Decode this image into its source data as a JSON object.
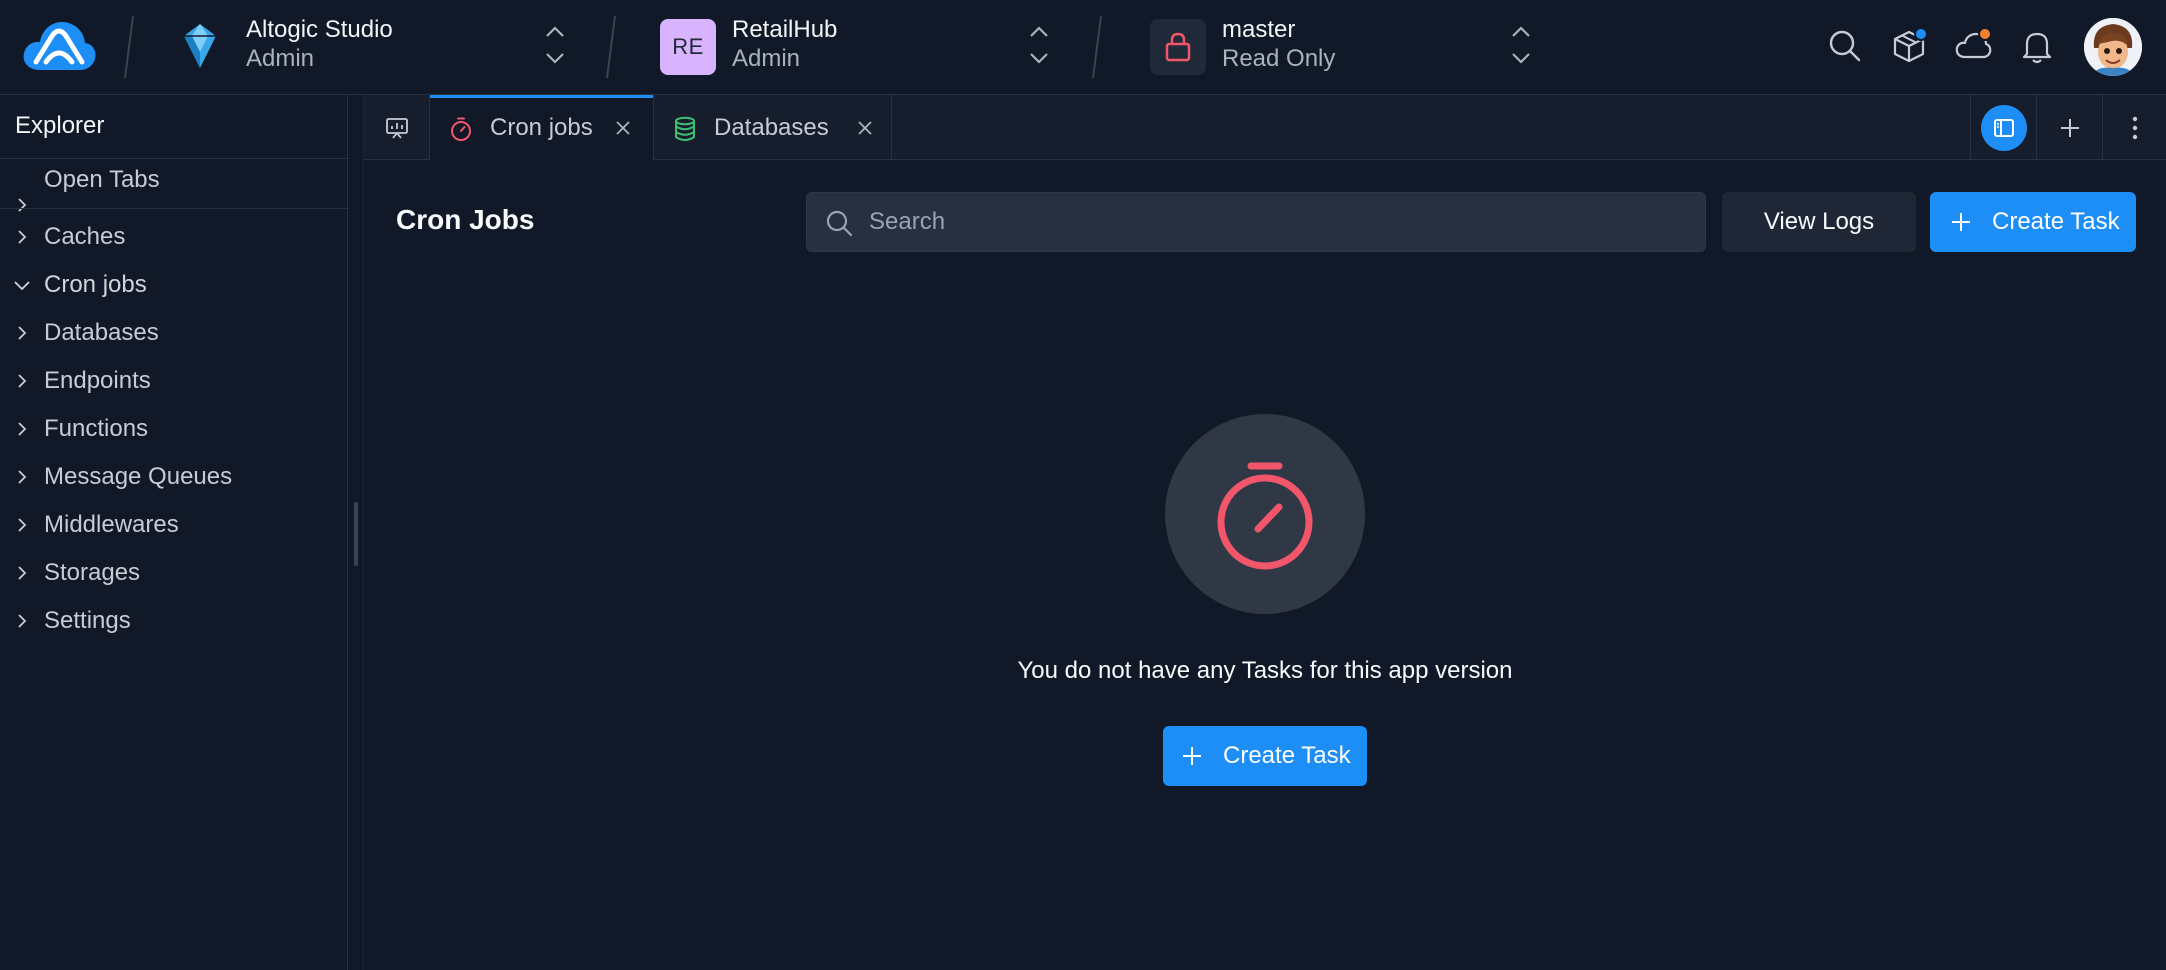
{
  "brand": {
    "logo_icon": "cloud-logo-icon"
  },
  "workspace": {
    "name": "Altogic Studio",
    "role": "Admin",
    "icon": "crystal-icon"
  },
  "organization": {
    "badge": "RE",
    "name": "RetailHub",
    "role": "Admin"
  },
  "environment": {
    "name": "master",
    "access": "Read Only",
    "icon": "lock-icon",
    "icon_color": "#f2566b"
  },
  "header_icons": [
    "search-icon",
    "package-icon",
    "cloud-icon",
    "bell-icon"
  ],
  "header_badges": {
    "package_dot": "#1d8ef5",
    "cloud_dot": "#f5802b"
  },
  "sidebar": {
    "title": "Explorer",
    "items": [
      {
        "label": "Open Tabs",
        "expanded": false
      },
      {
        "label": "Caches",
        "expanded": false
      },
      {
        "label": "Cron jobs",
        "expanded": true
      },
      {
        "label": "Databases",
        "expanded": false
      },
      {
        "label": "Endpoints",
        "expanded": false
      },
      {
        "label": "Functions",
        "expanded": false
      },
      {
        "label": "Message Queues",
        "expanded": false
      },
      {
        "label": "Middlewares",
        "expanded": false
      },
      {
        "label": "Storages",
        "expanded": false
      },
      {
        "label": "Settings",
        "expanded": false
      }
    ]
  },
  "tabs": [
    {
      "label": "Cron jobs",
      "icon": "stopwatch-icon",
      "icon_color": "#f2566b",
      "active": true
    },
    {
      "label": "Databases",
      "icon": "database-icon",
      "icon_color": "#3fbf72",
      "active": false
    }
  ],
  "main": {
    "title": "Cron Jobs",
    "search_placeholder": "Search",
    "search_value": "",
    "view_logs_label": "View Logs",
    "create_task_label": "Create Task",
    "empty_message": "You do not have any Tasks for this app version",
    "empty_create_label": "Create Task",
    "empty_icon": "stopwatch-icon",
    "accent": "#1d8ef5",
    "empty_icon_color": "#f2566b"
  }
}
